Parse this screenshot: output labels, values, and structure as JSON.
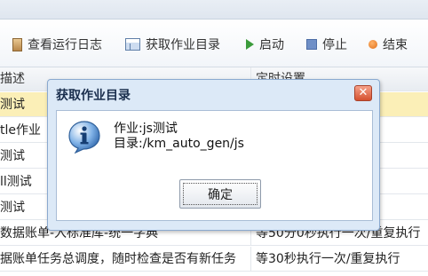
{
  "toolbar": {
    "items": [
      {
        "label": "查看运行日志",
        "icon": "log-icon"
      },
      {
        "label": "获取作业目录",
        "icon": "directory-icon"
      },
      {
        "label": "启动",
        "icon": "play-icon"
      },
      {
        "label": "停止",
        "icon": "stop-icon"
      },
      {
        "label": "结束",
        "icon": "end-icon"
      }
    ]
  },
  "grid": {
    "header": {
      "col1": "描述",
      "col2": "定时设置"
    },
    "rows": [
      {
        "col1": "测试",
        "col2": ""
      },
      {
        "col1": "tle作业",
        "col2": "复执行"
      },
      {
        "col1": "测试",
        "col2": ""
      },
      {
        "col1": "ll测试",
        "col2": ""
      },
      {
        "col1": "测试",
        "col2": ""
      },
      {
        "col1": "数据账单-入标准库-统一字典",
        "col2": "等50分0秒执行一次/重复执行"
      },
      {
        "col1": "据账单任务总调度，随时检查是否有新任务",
        "col2": "等30秒执行一次/重复执行"
      }
    ]
  },
  "dialog": {
    "title": "获取作业目录",
    "close_label": "✕",
    "line1": "作业:js测试",
    "line2": "目录:/km_auto_gen/js",
    "ok_label": "确定"
  }
}
